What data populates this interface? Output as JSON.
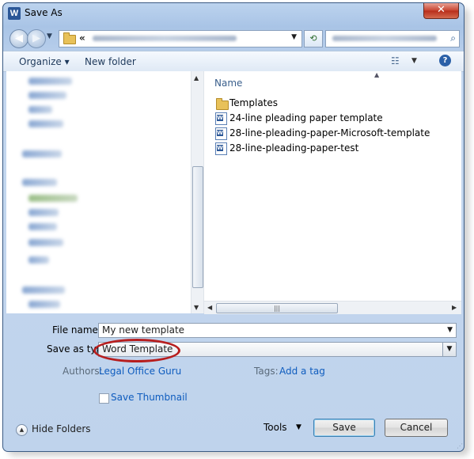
{
  "window": {
    "title": "Save As",
    "app_icon_letter": "W",
    "close_glyph": "✕"
  },
  "address_bar": {
    "chevron": "«",
    "refresh_glyph": "⟲"
  },
  "toolbar": {
    "organize_label": "Organize ▾",
    "new_folder_label": "New folder",
    "help_glyph": "?"
  },
  "file_list": {
    "column_name": "Name",
    "items": [
      {
        "label": "Templates",
        "icon": "folder-icon"
      },
      {
        "label": "24-line pleading paper template",
        "icon": "word-doc-icon"
      },
      {
        "label": "28-line-pleading-paper-Microsoft-template",
        "icon": "word-doc-icon"
      },
      {
        "label": "28-line-pleading-paper-test",
        "icon": "word-doc-icon"
      }
    ]
  },
  "form": {
    "file_name_label": "File name:",
    "file_name_value": "My new template",
    "save_type_label": "Save as type:",
    "save_type_value": "Word Template",
    "authors_label": "Authors:",
    "authors_value": "Legal Office Guru",
    "tags_label": "Tags:",
    "tags_value": "Add a tag",
    "thumbnail_label": "Save Thumbnail"
  },
  "footer": {
    "hide_folders_label": "Hide Folders",
    "tools_label": "Tools",
    "save_label": "Save",
    "cancel_label": "Cancel"
  },
  "colors": {
    "frame": "#a9c4e6",
    "link": "#0e5cbe",
    "highlight_oval": "#b71e1e"
  }
}
